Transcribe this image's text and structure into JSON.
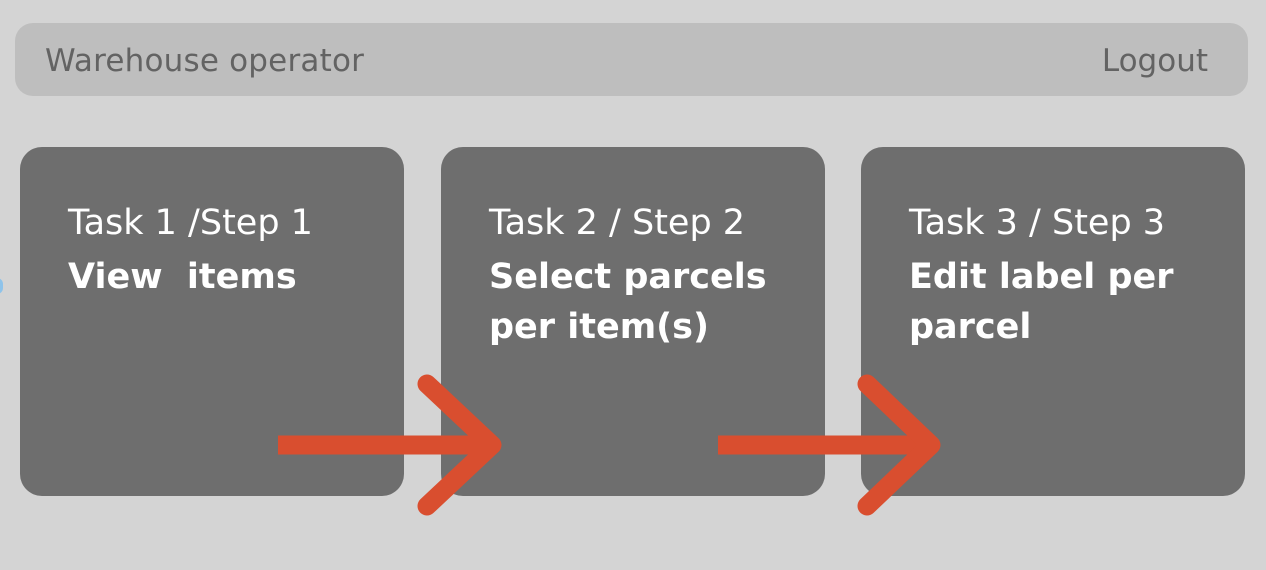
{
  "header": {
    "title": "Warehouse operator",
    "logout_label": "Logout"
  },
  "tasks": [
    {
      "heading": "Task 1 /Step 1",
      "description": "View  items"
    },
    {
      "heading": "Task 2 / Step 2",
      "description": "Select parcels per item(s)"
    },
    {
      "heading": "Task 3 / Step 3",
      "description": "Edit label per parcel"
    }
  ],
  "colors": {
    "background": "#d4d4d4",
    "topbar": "#bebebe",
    "card": "#6e6e6e",
    "arrow": "#d94e2f",
    "card_text": "#ffffff",
    "header_text": "#636363"
  }
}
